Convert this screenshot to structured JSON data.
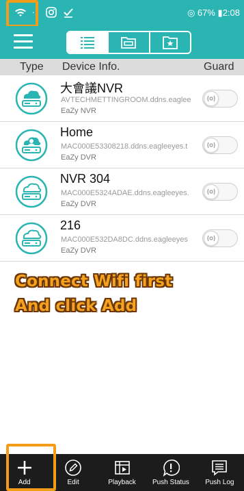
{
  "status_bar": {
    "right_text": "◎ 67% ▮2:08",
    "icons": [
      "wifi-icon",
      "instagram-icon",
      "checkmark-icon",
      "battery-icon"
    ]
  },
  "toolbar": {
    "tabs": [
      "list-icon",
      "folder-icon",
      "favorite-icon"
    ],
    "active_tab": 0,
    "accent_color": "#2bb5b2"
  },
  "table": {
    "headers": {
      "type": "Type",
      "device_info": "Device Info.",
      "guard": "Guard"
    }
  },
  "devices": [
    {
      "name": "大會議NVR",
      "address": "AVTECHMETTINGROOM.ddns.eaglee",
      "type": "EaZy NVR",
      "icon": "cloud-nvr-icon",
      "guard": false
    },
    {
      "name": "Home",
      "address": "MAC000E53308218.ddns.eagleeyes.t",
      "type": "EaZy DVR",
      "icon": "cloud-user-dvr-icon",
      "guard": false
    },
    {
      "name": "NVR 304",
      "address": "MAC000E5324ADAE.ddns.eagleeyes.",
      "type": "EaZy DVR",
      "icon": "cloud-dvr-icon",
      "guard": false
    },
    {
      "name": "216",
      "address": "MAC000E532DA8DC.ddns.eagleeyes",
      "type": "EaZy DVR",
      "icon": "cloud-dvr-icon",
      "guard": false
    }
  ],
  "annotation": {
    "line1": "Connect Wifi  first",
    "line2": "And click Add",
    "highlight_color": "#f39c1a"
  },
  "bottom_bar": {
    "items": [
      {
        "label": "Add",
        "icon": "plus-icon"
      },
      {
        "label": "Edit",
        "icon": "pencil-icon"
      },
      {
        "label": "Playback",
        "icon": "playback-icon"
      },
      {
        "label": "Push Status",
        "icon": "alert-bubble-icon"
      },
      {
        "label": "Push Log",
        "icon": "log-list-icon"
      }
    ]
  }
}
